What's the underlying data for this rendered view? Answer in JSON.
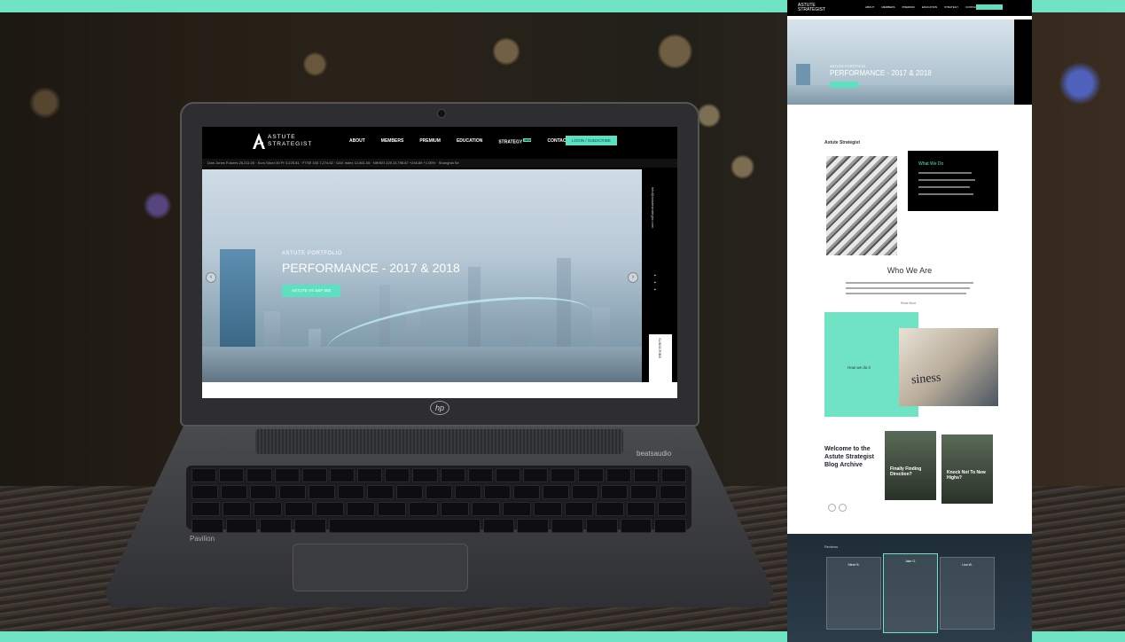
{
  "laptop": {
    "brand": "hp",
    "model": "Pavilion",
    "audio_badge": "beatsaudio"
  },
  "site": {
    "logo_line1": "ASTUTE",
    "logo_line2": "STRATEGIST",
    "nav": [
      "ABOUT",
      "MEMBERS",
      "PREMIUM",
      "EDUCATION",
      "STRATEGY",
      "CONTACT"
    ],
    "strategy_badge": "NEW",
    "login_label": "LOGIN / SUBSCRIBE",
    "ticker": "Dow Jones Futures 26,211.00  ·  Euro Stoxx 50 Pr 3,225.81  ·  FTSE 100 7,274.62  ·  DAX Index 12,661.08  ·  NIKKEI 225 23,798.87 +246.89 +1.05%  ·  Shanghai Se",
    "hero_sub": "ASTUTE PORTFOLIO",
    "hero_title": "PERFORMANCE - 2017 & 2018",
    "hero_button": "ASTUTE VS S&P 500",
    "side_email": "info@astutestrategist.com",
    "side_label": "SUBSCRIBE"
  },
  "page": {
    "hero_sub": "ASTUTE PORTFOLIO",
    "hero_title": "PERFORMANCE - 2017 & 2018",
    "section_label": "Astute Strategist",
    "what_title": "What We Do",
    "who_title": "Who We Are",
    "read_more": "Read More",
    "how_title": "How we do it",
    "biz_word": "siness",
    "welcome_title": "Welcome to the Astute Strategist Blog Archive",
    "cards": [
      {
        "title": "Finally Finding Direction?"
      },
      {
        "title": "Knock Not To New Highs?"
      }
    ],
    "reviews_label": "Reviews",
    "reviewers": [
      "Steve B.",
      "Jake G.",
      "Lisa W."
    ]
  },
  "colors": {
    "accent": "#6fe3c4",
    "nav_bg": "#000000"
  }
}
